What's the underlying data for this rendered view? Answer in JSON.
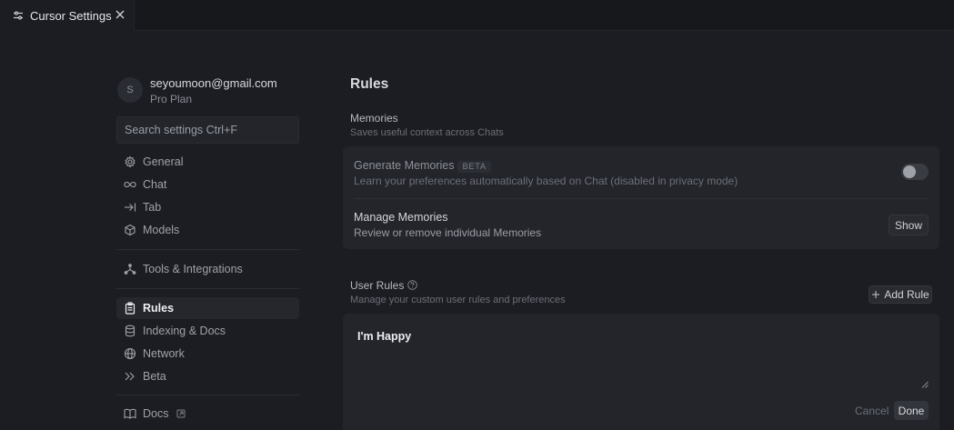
{
  "tab": {
    "title": "Cursor Settings",
    "icon": "sliders-icon",
    "close_icon": "close-icon"
  },
  "account": {
    "avatar_letter": "S",
    "email": "seyoumoon@gmail.com",
    "plan": "Pro Plan"
  },
  "search": {
    "placeholder": "Search settings Ctrl+F"
  },
  "sidebar": {
    "items": [
      {
        "label": "General",
        "icon": "gear-icon"
      },
      {
        "label": "Chat",
        "icon": "infinity-icon"
      },
      {
        "label": "Tab",
        "icon": "arrow-right-bar-icon"
      },
      {
        "label": "Models",
        "icon": "cube-icon"
      },
      {
        "label": "Tools & Integrations",
        "icon": "nodes-icon"
      },
      {
        "label": "Rules",
        "icon": "clipboard-icon",
        "active": true
      },
      {
        "label": "Indexing & Docs",
        "icon": "database-icon"
      },
      {
        "label": "Network",
        "icon": "globe-icon"
      },
      {
        "label": "Beta",
        "icon": "double-chevron-icon"
      },
      {
        "label": "Docs",
        "icon": "book-icon"
      }
    ]
  },
  "main": {
    "title": "Rules",
    "memories": {
      "title": "Memories",
      "subtitle": "Saves useful context across Chats",
      "generate": {
        "label": "Generate Memories",
        "badge": "BETA",
        "description": "Learn your preferences automatically based on Chat (disabled in privacy mode)",
        "enabled": false
      },
      "manage": {
        "label": "Manage Memories",
        "description": "Review or remove individual Memories",
        "button": "Show"
      }
    },
    "user_rules": {
      "title": "User Rules",
      "subtitle": "Manage your custom user rules and preferences",
      "add_button": "Add Rule",
      "rule_text": "I'm Happy",
      "cancel": "Cancel",
      "done": "Done"
    }
  },
  "colors": {
    "background": "#1c1d22",
    "card": "#23252b",
    "text": "#cfd1d6",
    "muted": "#6c6f78"
  }
}
